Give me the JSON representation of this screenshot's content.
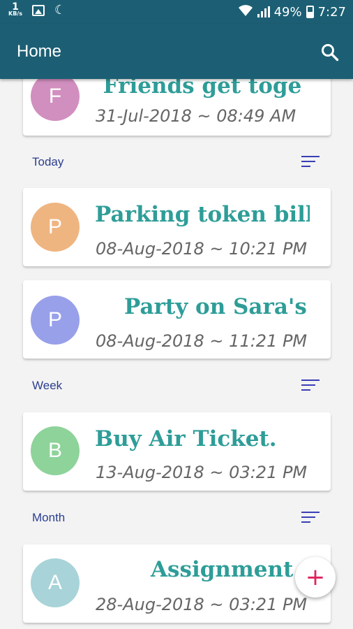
{
  "status_bar": {
    "speed_value": "1",
    "speed_unit": "KB/s",
    "battery": "49%",
    "time": "7:27",
    "icons": [
      "image-icon",
      "moon-icon",
      "wifi-icon",
      "signal-icon",
      "battery-icon"
    ]
  },
  "app_bar": {
    "title": "Home",
    "search_icon": "search-icon"
  },
  "sections": [
    {
      "label": "",
      "cards": [
        {
          "initial": "F",
          "title": "Friends get toge",
          "date": "31-Jul-2018 ~ 08:49 AM",
          "avatar_color": "#d18fbf"
        }
      ]
    },
    {
      "label": "Today",
      "cards": [
        {
          "initial": "P",
          "title": "Parking token bill",
          "date": "08-Aug-2018 ~ 10:21 PM",
          "avatar_color": "#efb580"
        },
        {
          "initial": "P",
          "title": "Party on Sara's",
          "date": "08-Aug-2018 ~ 11:21 PM",
          "avatar_color": "#98a0ea"
        }
      ]
    },
    {
      "label": "Week",
      "cards": [
        {
          "initial": "B",
          "title": "Buy Air Ticket.",
          "date": "13-Aug-2018 ~ 03:21 PM",
          "avatar_color": "#8ed39a"
        }
      ]
    },
    {
      "label": "Month",
      "cards": [
        {
          "initial": "A",
          "title": "Assignment",
          "date": "28-Aug-2018 ~ 03:21 PM",
          "avatar_color": "#a8d3d8"
        }
      ]
    }
  ],
  "fab": {
    "label": "+",
    "accent": "#e0245e"
  },
  "colors": {
    "primary": "#1c5f74",
    "title_text": "#2e9d98",
    "section_text": "#2b3e8f"
  }
}
